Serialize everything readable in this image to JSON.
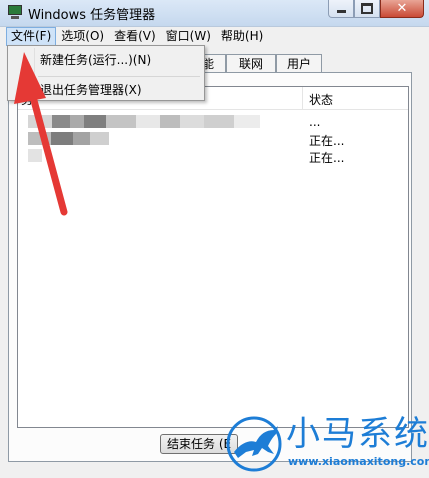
{
  "window": {
    "title": "Windows 任务管理器",
    "controls": {
      "minimize": "minimize-icon",
      "maximize": "maximize-icon",
      "close": "close-icon"
    }
  },
  "menubar": {
    "items": [
      "文件(F)",
      "选项(O)",
      "查看(V)",
      "窗口(W)",
      "帮助(H)"
    ],
    "active_index": 0
  },
  "file_menu": {
    "items": [
      "新建任务(运行...)(N)",
      "退出任务管理器(X)"
    ]
  },
  "tabs": {
    "visible": [
      "能",
      "联网",
      "用户"
    ]
  },
  "listview": {
    "columns": [
      "务",
      "状态"
    ],
    "rows": [
      {
        "status": "..."
      },
      {
        "status": "正在..."
      },
      {
        "status": "正在..."
      }
    ]
  },
  "buttons": {
    "end_task": "结束任务 (E"
  },
  "watermark": {
    "brand": "小马系统",
    "url": "www.xiaomaxitong.com",
    "color": "#1d7dd6"
  },
  "colors": {
    "annotation_arrow": "#e53935",
    "active_menu": "#cfe3f8"
  }
}
